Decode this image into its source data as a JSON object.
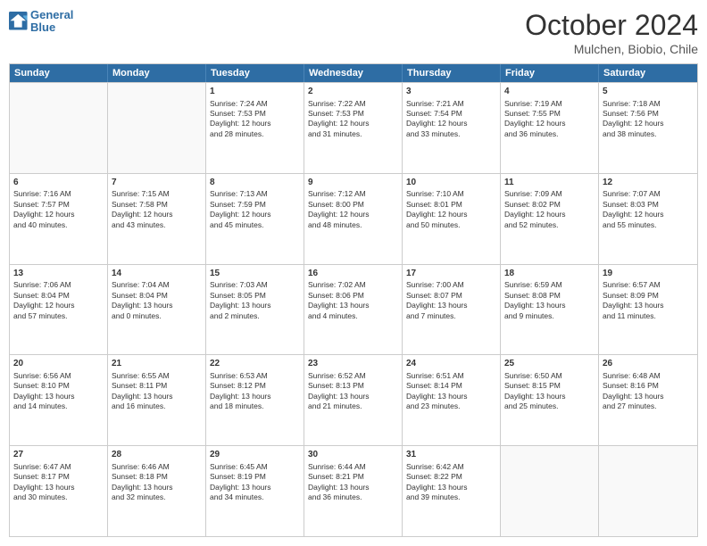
{
  "header": {
    "logo_line1": "General",
    "logo_line2": "Blue",
    "month": "October 2024",
    "location": "Mulchen, Biobio, Chile"
  },
  "weekdays": [
    "Sunday",
    "Monday",
    "Tuesday",
    "Wednesday",
    "Thursday",
    "Friday",
    "Saturday"
  ],
  "weeks": [
    [
      {
        "day": "",
        "empty": true
      },
      {
        "day": "",
        "empty": true
      },
      {
        "day": "1",
        "sunrise": "Sunrise: 7:24 AM",
        "sunset": "Sunset: 7:53 PM",
        "daylight": "Daylight: 12 hours and 28 minutes."
      },
      {
        "day": "2",
        "sunrise": "Sunrise: 7:22 AM",
        "sunset": "Sunset: 7:53 PM",
        "daylight": "Daylight: 12 hours and 31 minutes."
      },
      {
        "day": "3",
        "sunrise": "Sunrise: 7:21 AM",
        "sunset": "Sunset: 7:54 PM",
        "daylight": "Daylight: 12 hours and 33 minutes."
      },
      {
        "day": "4",
        "sunrise": "Sunrise: 7:19 AM",
        "sunset": "Sunset: 7:55 PM",
        "daylight": "Daylight: 12 hours and 36 minutes."
      },
      {
        "day": "5",
        "sunrise": "Sunrise: 7:18 AM",
        "sunset": "Sunset: 7:56 PM",
        "daylight": "Daylight: 12 hours and 38 minutes."
      }
    ],
    [
      {
        "day": "6",
        "sunrise": "Sunrise: 7:16 AM",
        "sunset": "Sunset: 7:57 PM",
        "daylight": "Daylight: 12 hours and 40 minutes."
      },
      {
        "day": "7",
        "sunrise": "Sunrise: 7:15 AM",
        "sunset": "Sunset: 7:58 PM",
        "daylight": "Daylight: 12 hours and 43 minutes."
      },
      {
        "day": "8",
        "sunrise": "Sunrise: 7:13 AM",
        "sunset": "Sunset: 7:59 PM",
        "daylight": "Daylight: 12 hours and 45 minutes."
      },
      {
        "day": "9",
        "sunrise": "Sunrise: 7:12 AM",
        "sunset": "Sunset: 8:00 PM",
        "daylight": "Daylight: 12 hours and 48 minutes."
      },
      {
        "day": "10",
        "sunrise": "Sunrise: 7:10 AM",
        "sunset": "Sunset: 8:01 PM",
        "daylight": "Daylight: 12 hours and 50 minutes."
      },
      {
        "day": "11",
        "sunrise": "Sunrise: 7:09 AM",
        "sunset": "Sunset: 8:02 PM",
        "daylight": "Daylight: 12 hours and 52 minutes."
      },
      {
        "day": "12",
        "sunrise": "Sunrise: 7:07 AM",
        "sunset": "Sunset: 8:03 PM",
        "daylight": "Daylight: 12 hours and 55 minutes."
      }
    ],
    [
      {
        "day": "13",
        "sunrise": "Sunrise: 7:06 AM",
        "sunset": "Sunset: 8:04 PM",
        "daylight": "Daylight: 12 hours and 57 minutes."
      },
      {
        "day": "14",
        "sunrise": "Sunrise: 7:04 AM",
        "sunset": "Sunset: 8:04 PM",
        "daylight": "Daylight: 13 hours and 0 minutes."
      },
      {
        "day": "15",
        "sunrise": "Sunrise: 7:03 AM",
        "sunset": "Sunset: 8:05 PM",
        "daylight": "Daylight: 13 hours and 2 minutes."
      },
      {
        "day": "16",
        "sunrise": "Sunrise: 7:02 AM",
        "sunset": "Sunset: 8:06 PM",
        "daylight": "Daylight: 13 hours and 4 minutes."
      },
      {
        "day": "17",
        "sunrise": "Sunrise: 7:00 AM",
        "sunset": "Sunset: 8:07 PM",
        "daylight": "Daylight: 13 hours and 7 minutes."
      },
      {
        "day": "18",
        "sunrise": "Sunrise: 6:59 AM",
        "sunset": "Sunset: 8:08 PM",
        "daylight": "Daylight: 13 hours and 9 minutes."
      },
      {
        "day": "19",
        "sunrise": "Sunrise: 6:57 AM",
        "sunset": "Sunset: 8:09 PM",
        "daylight": "Daylight: 13 hours and 11 minutes."
      }
    ],
    [
      {
        "day": "20",
        "sunrise": "Sunrise: 6:56 AM",
        "sunset": "Sunset: 8:10 PM",
        "daylight": "Daylight: 13 hours and 14 minutes."
      },
      {
        "day": "21",
        "sunrise": "Sunrise: 6:55 AM",
        "sunset": "Sunset: 8:11 PM",
        "daylight": "Daylight: 13 hours and 16 minutes."
      },
      {
        "day": "22",
        "sunrise": "Sunrise: 6:53 AM",
        "sunset": "Sunset: 8:12 PM",
        "daylight": "Daylight: 13 hours and 18 minutes."
      },
      {
        "day": "23",
        "sunrise": "Sunrise: 6:52 AM",
        "sunset": "Sunset: 8:13 PM",
        "daylight": "Daylight: 13 hours and 21 minutes."
      },
      {
        "day": "24",
        "sunrise": "Sunrise: 6:51 AM",
        "sunset": "Sunset: 8:14 PM",
        "daylight": "Daylight: 13 hours and 23 minutes."
      },
      {
        "day": "25",
        "sunrise": "Sunrise: 6:50 AM",
        "sunset": "Sunset: 8:15 PM",
        "daylight": "Daylight: 13 hours and 25 minutes."
      },
      {
        "day": "26",
        "sunrise": "Sunrise: 6:48 AM",
        "sunset": "Sunset: 8:16 PM",
        "daylight": "Daylight: 13 hours and 27 minutes."
      }
    ],
    [
      {
        "day": "27",
        "sunrise": "Sunrise: 6:47 AM",
        "sunset": "Sunset: 8:17 PM",
        "daylight": "Daylight: 13 hours and 30 minutes."
      },
      {
        "day": "28",
        "sunrise": "Sunrise: 6:46 AM",
        "sunset": "Sunset: 8:18 PM",
        "daylight": "Daylight: 13 hours and 32 minutes."
      },
      {
        "day": "29",
        "sunrise": "Sunrise: 6:45 AM",
        "sunset": "Sunset: 8:19 PM",
        "daylight": "Daylight: 13 hours and 34 minutes."
      },
      {
        "day": "30",
        "sunrise": "Sunrise: 6:44 AM",
        "sunset": "Sunset: 8:21 PM",
        "daylight": "Daylight: 13 hours and 36 minutes."
      },
      {
        "day": "31",
        "sunrise": "Sunrise: 6:42 AM",
        "sunset": "Sunset: 8:22 PM",
        "daylight": "Daylight: 13 hours and 39 minutes."
      },
      {
        "day": "",
        "empty": true
      },
      {
        "day": "",
        "empty": true
      }
    ]
  ]
}
